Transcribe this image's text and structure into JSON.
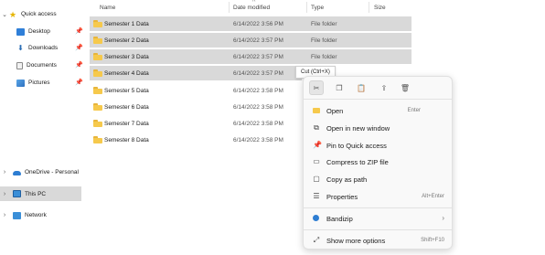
{
  "sidebar": {
    "quick_access": {
      "label": "Quick access",
      "chevron": "⌄"
    },
    "items": [
      {
        "label": "Desktop"
      },
      {
        "label": "Downloads"
      },
      {
        "label": "Documents"
      },
      {
        "label": "Pictures"
      }
    ],
    "onedrive": {
      "label": "OneDrive - Personal",
      "chevron": "›"
    },
    "this_pc": {
      "label": "This PC",
      "chevron": "›"
    },
    "network": {
      "label": "Network",
      "chevron": "›"
    }
  },
  "columns": {
    "name": "Name",
    "date": "Date modified",
    "type": "Type",
    "size": "Size"
  },
  "rows": [
    {
      "name": "Semester 1 Data",
      "date": "6/14/2022 3:56 PM",
      "type": "File folder",
      "selected": true
    },
    {
      "name": "Semester 2 Data",
      "date": "6/14/2022 3:57 PM",
      "type": "File folder",
      "selected": true
    },
    {
      "name": "Semester 3 Data",
      "date": "6/14/2022 3:57 PM",
      "type": "File folder",
      "selected": true
    },
    {
      "name": "Semester 4 Data",
      "date": "6/14/2022 3:57 PM",
      "type": "",
      "selected": true
    },
    {
      "name": "Semester 5 Data",
      "date": "6/14/2022 3:58 PM",
      "type": "",
      "selected": false
    },
    {
      "name": "Semester 6 Data",
      "date": "6/14/2022 3:58 PM",
      "type": "",
      "selected": false
    },
    {
      "name": "Semester 7 Data",
      "date": "6/14/2022 3:58 PM",
      "type": "",
      "selected": false
    },
    {
      "name": "Semester 8 Data",
      "date": "6/14/2022 3:58 PM",
      "type": "",
      "selected": false
    }
  ],
  "tooltip": "Cut (Ctrl+X)",
  "context_menu": {
    "toolbar": [
      {
        "icon": "cut-icon",
        "glyph": "✂"
      },
      {
        "icon": "copy-icon",
        "glyph": "❐"
      },
      {
        "icon": "paste-icon",
        "glyph": "📋"
      },
      {
        "icon": "share-icon",
        "glyph": "⇪"
      },
      {
        "icon": "delete-icon",
        "glyph": "🗑"
      }
    ],
    "items": [
      {
        "label": "Open",
        "shortcut": "Enter",
        "icon": "folder-open-icon"
      },
      {
        "label": "Open in new window",
        "shortcut": "",
        "icon": "new-window-icon"
      },
      {
        "label": "Pin to Quick access",
        "shortcut": "",
        "icon": "pin-icon"
      },
      {
        "label": "Compress to ZIP file",
        "shortcut": "",
        "icon": "zip-icon"
      },
      {
        "label": "Copy as path",
        "shortcut": "",
        "icon": "copy-path-icon"
      },
      {
        "label": "Properties",
        "shortcut": "Alt+Enter",
        "icon": "properties-icon"
      },
      {
        "label": "Bandizip",
        "shortcut": "",
        "icon": "bandizip-icon"
      },
      {
        "label": "Show more options",
        "shortcut": "Shift+F10",
        "icon": "more-options-icon"
      }
    ]
  },
  "colors": {
    "selection": "#d9d9d9",
    "folder": "#f6c94c",
    "accent": "#2d7dd2"
  }
}
